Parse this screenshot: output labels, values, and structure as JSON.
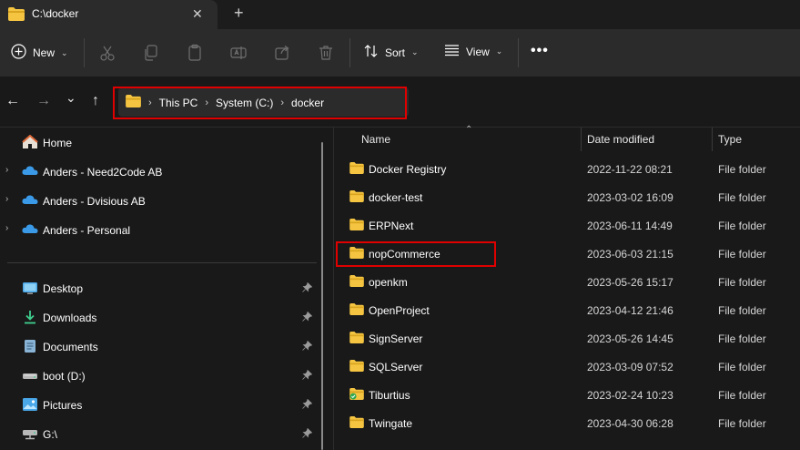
{
  "window": {
    "tab_title": "C:\\docker",
    "close_glyph": "✕",
    "add_glyph": "+"
  },
  "command_bar": {
    "new_label": "New",
    "sort_label": "Sort",
    "view_label": "View",
    "more_glyph": "•••",
    "chevron": "⌄"
  },
  "nav": {
    "back_glyph": "←",
    "forward_glyph": "→",
    "recent_glyph": "⌄",
    "up_glyph": "↑"
  },
  "breadcrumb": {
    "separator": "›",
    "items": [
      "This PC",
      "System (C:)",
      "docker"
    ]
  },
  "sidebar": {
    "expander": "›",
    "pin_glyph": "📌",
    "items": [
      {
        "label": "Home",
        "icon": "home-icon",
        "expandable": false,
        "pinned": false
      },
      {
        "label": "Anders - Need2Code AB",
        "icon": "onedrive-icon",
        "expandable": true,
        "pinned": false
      },
      {
        "label": "Anders - Dvisious AB",
        "icon": "onedrive-icon",
        "expandable": true,
        "pinned": false
      },
      {
        "label": "Anders - Personal",
        "icon": "onedrive-icon",
        "expandable": true,
        "pinned": false
      },
      {
        "label": "Desktop",
        "icon": "desktop-icon",
        "expandable": false,
        "pinned": true
      },
      {
        "label": "Downloads",
        "icon": "downloads-icon",
        "expandable": false,
        "pinned": true
      },
      {
        "label": "Documents",
        "icon": "documents-icon",
        "expandable": false,
        "pinned": true
      },
      {
        "label": "boot (D:)",
        "icon": "drive-icon",
        "expandable": false,
        "pinned": true
      },
      {
        "label": "Pictures",
        "icon": "pictures-icon",
        "expandable": false,
        "pinned": true
      },
      {
        "label": "G:\\",
        "icon": "network-drive-icon",
        "expandable": false,
        "pinned": true
      }
    ]
  },
  "file_list": {
    "columns": {
      "name": "Name",
      "date": "Date modified",
      "type": "Type"
    },
    "sort_caret": "⌃",
    "rows": [
      {
        "name": "Docker Registry",
        "date": "2022-11-22 08:21",
        "type": "File folder"
      },
      {
        "name": "docker-test",
        "date": "2023-03-02 16:09",
        "type": "File folder"
      },
      {
        "name": "ERPNext",
        "date": "2023-06-11 14:49",
        "type": "File folder"
      },
      {
        "name": "nopCommerce",
        "date": "2023-06-03 21:15",
        "type": "File folder"
      },
      {
        "name": "openkm",
        "date": "2023-05-26 15:17",
        "type": "File folder"
      },
      {
        "name": "OpenProject",
        "date": "2023-04-12 21:46",
        "type": "File folder"
      },
      {
        "name": "SignServer",
        "date": "2023-05-26 14:45",
        "type": "File folder"
      },
      {
        "name": "SQLServer",
        "date": "2023-03-09 07:52",
        "type": "File folder"
      },
      {
        "name": "Tiburtius",
        "date": "2023-02-24 10:23",
        "type": "File folder"
      },
      {
        "name": "Twingate",
        "date": "2023-04-30 06:28",
        "type": "File folder"
      }
    ]
  },
  "colors": {
    "folder": "#f5c542",
    "folder_dark": "#d9a520",
    "highlight_box": "#e00000",
    "onedrive": "#3b9ae8"
  }
}
